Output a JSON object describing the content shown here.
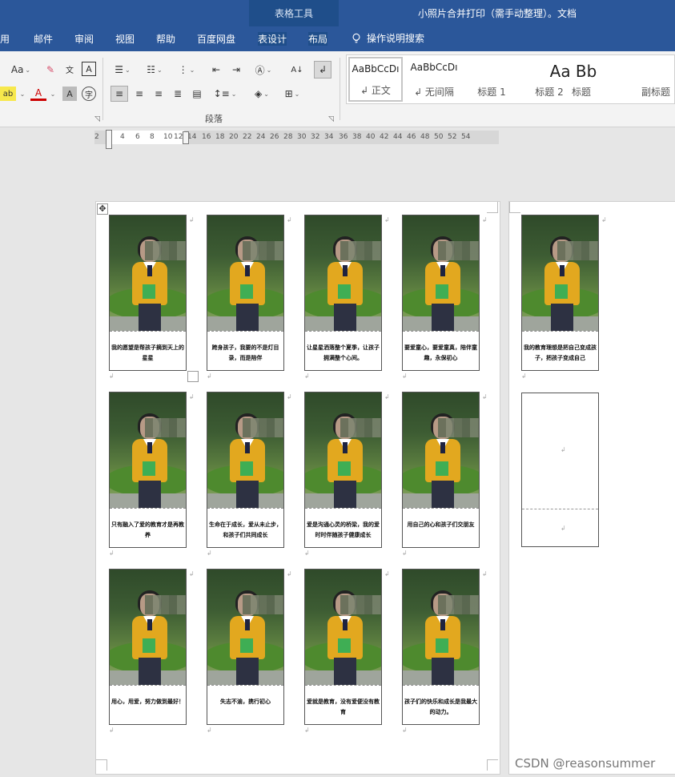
{
  "titlebar": {
    "context_tab_label": "表格工具",
    "document_title": "小照片合并打印（需手动整理）。文档"
  },
  "tabs": [
    "用",
    "邮件",
    "审阅",
    "视图",
    "帮助",
    "百度网盘",
    "表设计",
    "布局"
  ],
  "tell_me": "操作说明搜索",
  "ribbon": {
    "font_aa": "Aa",
    "paragraph_group": "段落",
    "styles": [
      {
        "preview": "AaBbCcDı",
        "name": "↲ 正文"
      },
      {
        "preview": "AaBbCcDı",
        "name": "↲ 无间隔"
      },
      {
        "preview": "",
        "name": "标题 1"
      },
      {
        "preview": "",
        "name": "标题 2"
      },
      {
        "preview": "Aa Bb",
        "name": "标题"
      },
      {
        "preview": "",
        "name": "副标题"
      }
    ]
  },
  "ruler": {
    "numbers": [
      "2",
      "2",
      "4",
      "6",
      "8",
      "10",
      "12",
      "14",
      "16",
      "18",
      "20",
      "22",
      "24",
      "26",
      "28",
      "30",
      "32",
      "34",
      "36",
      "38",
      "40",
      "42",
      "44",
      "46",
      "48",
      "50",
      "52",
      "54"
    ]
  },
  "cards": [
    "我的愿望是帮孩子摘到天上的星星",
    "跨身孩子，我要的不是灯目录，而是陪伴",
    "让星星洒落整个夏季，让孩子拥满整个心间。",
    "要爱童心，要爱童真，陪伴童趣，永保初心",
    "只有融入了爱的教育才是再教养",
    "生命在于成长，爱从未止步，和孩子们共同成长",
    "爱是沟通心灵的桥梁，我的爱时时伴随孩子健康成长",
    "用自己的心和孩子们交朋友",
    "用心，用爱，努力做到最好！",
    "失志不渝，携行初心",
    "爱就是教育，没有爱便没有教育",
    "孩子们的快乐和成长是我最大的动力。",
    "我的教育理想是把自己变成孩子，把孩子变成自己"
  ],
  "watermark": "CSDN @reasonsummer"
}
